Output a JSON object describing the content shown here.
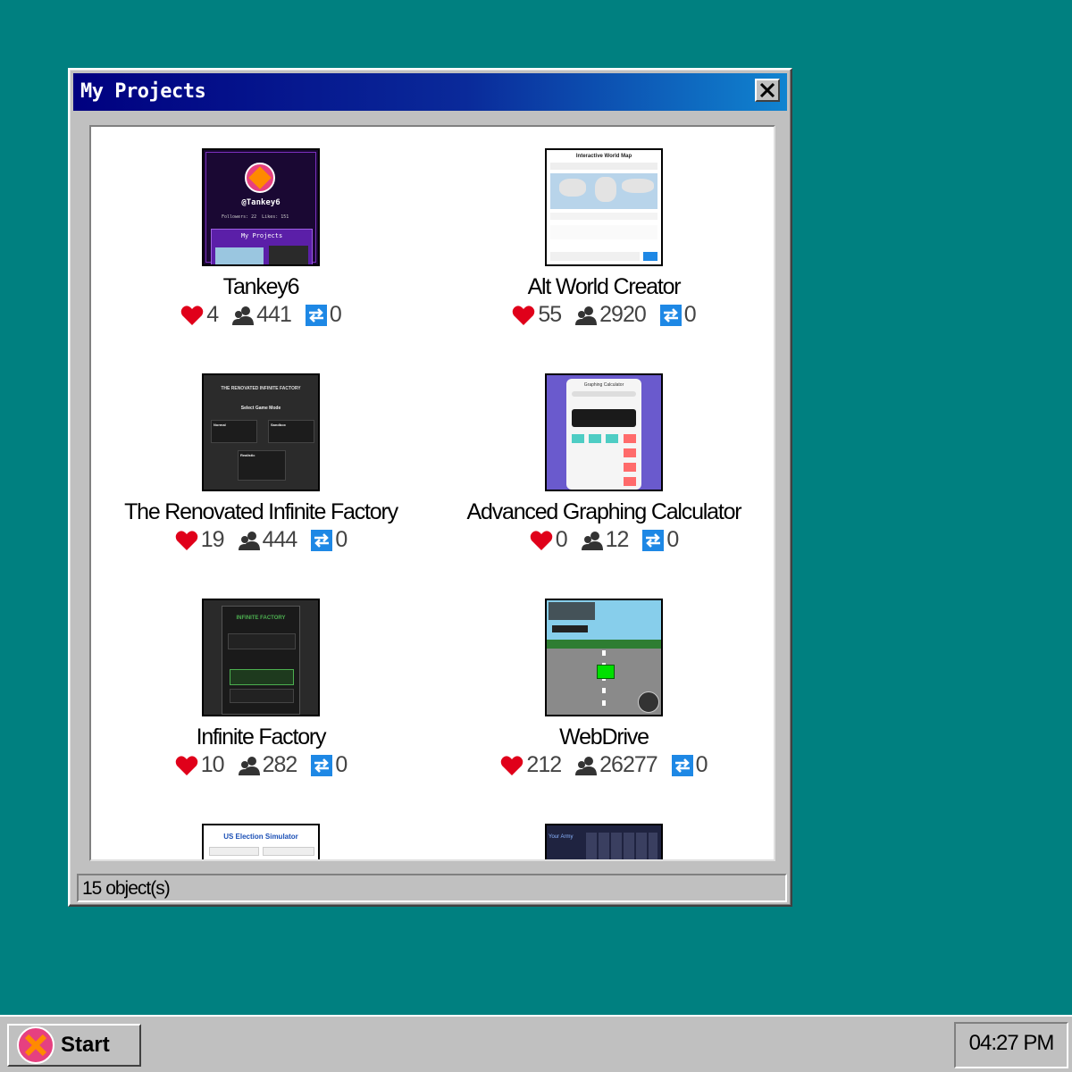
{
  "window": {
    "title": "My Projects",
    "status": "15 object(s)"
  },
  "projects": [
    {
      "name": "Tankey6",
      "likes": "4",
      "users": "441",
      "remixes": "0"
    },
    {
      "name": "Alt World Creator",
      "likes": "55",
      "users": "2920",
      "remixes": "0"
    },
    {
      "name": "The Renovated Infinite Factory",
      "likes": "19",
      "users": "444",
      "remixes": "0"
    },
    {
      "name": "Advanced Graphing Calculator",
      "likes": "0",
      "users": "12",
      "remixes": "0"
    },
    {
      "name": "Infinite Factory",
      "likes": "10",
      "users": "282",
      "remixes": "0"
    },
    {
      "name": "WebDrive",
      "likes": "212",
      "users": "26277",
      "remixes": "0"
    }
  ],
  "thumbs": {
    "tankey": {
      "handle": "@Tankey6",
      "followers": "Followers: 22",
      "likes": "Likes: 151",
      "section": "My Projects"
    },
    "worldmap": {
      "title": "Interactive World Map"
    },
    "factory": {
      "title": "THE RENOVATED INFINITE FACTORY",
      "subtitle": "Select Game Mode",
      "mode1": "Normal",
      "mode2": "Sandbox",
      "mode3": "Realistic"
    },
    "calc": {
      "title": "Graphing Calculator"
    },
    "infinite": {
      "title": "INFINITE FACTORY"
    },
    "election": {
      "title": "US Election Simulator"
    },
    "army": {
      "title": "Your Army"
    }
  },
  "taskbar": {
    "start_label": "Start",
    "clock": "04:27 PM"
  },
  "colors": {
    "desktop": "#008080",
    "heart": "#e0001a",
    "remix": "#1e88e5"
  }
}
